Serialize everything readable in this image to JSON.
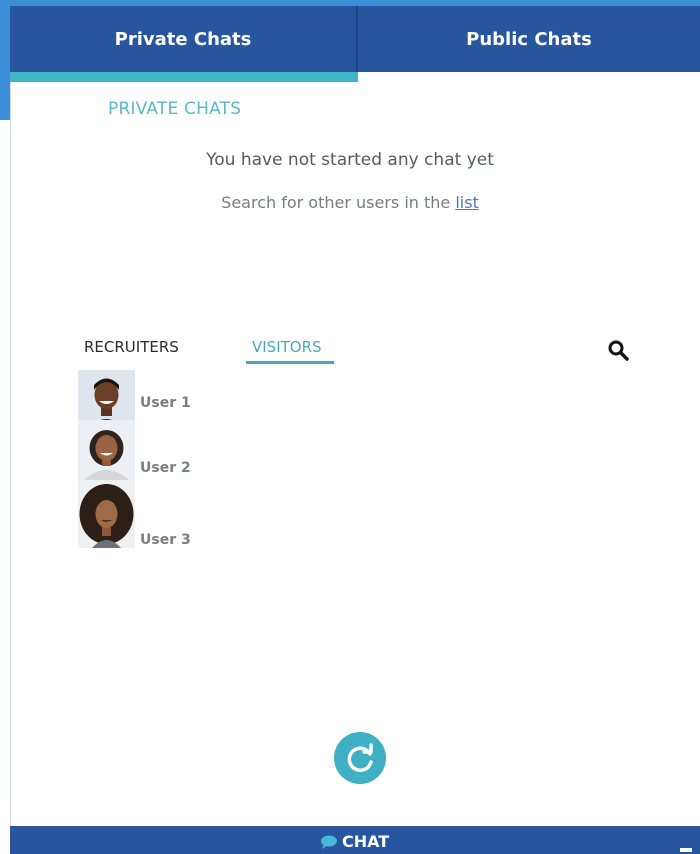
{
  "header": {
    "tabs": [
      {
        "label": "Private Chats",
        "active": true
      },
      {
        "label": "Public Chats",
        "active": false
      }
    ]
  },
  "private_chats": {
    "section_title": "PRIVATE CHATS",
    "empty_title": "You have not started any chat yet",
    "empty_sub_prefix": "Search for other users in the ",
    "empty_sub_link": "list"
  },
  "user_tabs": {
    "recruiters": "RECRUITERS",
    "visitors": "VISITORS",
    "active": "visitors"
  },
  "users": [
    {
      "name": "User 1"
    },
    {
      "name": "User 2"
    },
    {
      "name": "User 3"
    }
  ],
  "footer": {
    "chat_label": "CHAT"
  },
  "colors": {
    "header_blue": "#27569f",
    "accent_teal": "#3fb5c5"
  }
}
